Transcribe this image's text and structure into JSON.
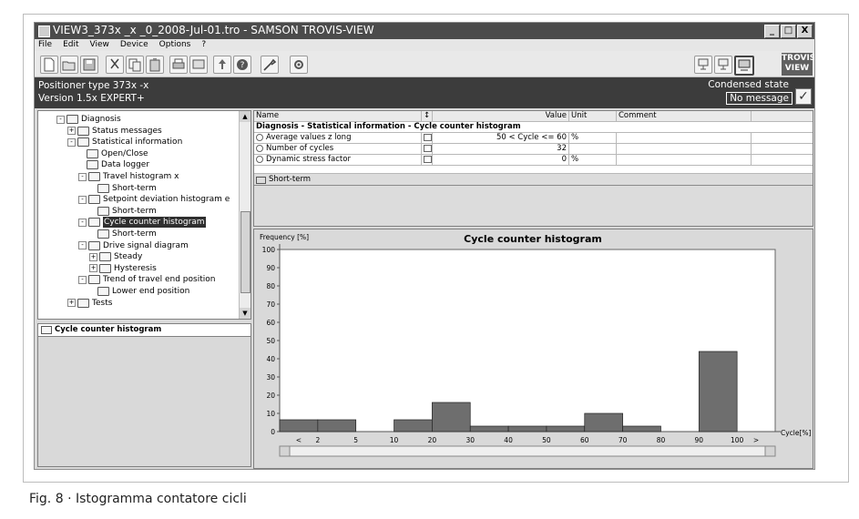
{
  "window": {
    "title": "VIEW3_373x _x _0_2008-Jul-01.tro - SAMSON TROVIS-VIEW",
    "controls": [
      "_",
      "□",
      "X"
    ]
  },
  "menu": [
    "File",
    "Edit",
    "View",
    "Device",
    "Options",
    "?"
  ],
  "toolbar": {
    "icons": [
      "new-icon",
      "open-icon",
      "save-icon",
      "cut-icon",
      "copy-icon",
      "paste-icon",
      "print-icon",
      "display-icon",
      "upload-icon",
      "help-icon",
      "tool-icon",
      "settings-icon"
    ],
    "right_icons": [
      "device-online-icon",
      "device-offline-icon",
      "monitor-icon"
    ],
    "logo_line1": "TROVIS",
    "logo_line2": "VIEW"
  },
  "infobar": {
    "positioner": "Positioner type 373x -x",
    "version": "Version 1.5x EXPERT+",
    "condensed_state": "Condensed state",
    "message": "No message"
  },
  "tree": [
    {
      "label": "Diagnosis",
      "level": 0,
      "pm": "-"
    },
    {
      "label": "Status messages",
      "level": 1,
      "pm": "+"
    },
    {
      "label": "Statistical information",
      "level": 1,
      "pm": "-"
    },
    {
      "label": "Open/Close",
      "level": 2,
      "pm": ""
    },
    {
      "label": "Data logger",
      "level": 2,
      "pm": ""
    },
    {
      "label": "Travel histogram x",
      "level": 2,
      "pm": "-"
    },
    {
      "label": "Short-term",
      "level": 3,
      "pm": ""
    },
    {
      "label": "Setpoint deviation histogram e",
      "level": 2,
      "pm": "-"
    },
    {
      "label": "Short-term",
      "level": 3,
      "pm": ""
    },
    {
      "label": "Cycle counter histogram",
      "level": 2,
      "pm": "-",
      "selected": true
    },
    {
      "label": "Short-term",
      "level": 3,
      "pm": ""
    },
    {
      "label": "Drive signal diagram",
      "level": 2,
      "pm": "-"
    },
    {
      "label": "Steady",
      "level": 3,
      "pm": "+"
    },
    {
      "label": "Hysteresis",
      "level": 3,
      "pm": "+"
    },
    {
      "label": "Trend of travel end position",
      "level": 2,
      "pm": "-"
    },
    {
      "label": "Lower end position",
      "level": 3,
      "pm": ""
    },
    {
      "label": "Tests",
      "level": 1,
      "pm": "+"
    }
  ],
  "lower_panel": {
    "header": "Cycle counter histogram"
  },
  "grid": {
    "columns": [
      "Name",
      "↕",
      "Value",
      "Unit",
      "Comment"
    ],
    "section": "Diagnosis - Statistical information - Cycle counter histogram",
    "rows": [
      {
        "name": "Average values z long",
        "value": "50 < Cycle <= 60",
        "unit": "%"
      },
      {
        "name": "Number of cycles",
        "value": "32",
        "unit": ""
      },
      {
        "name": "Dynamic stress factor",
        "value": "0",
        "unit": "%"
      }
    ],
    "subfolder": "Short-term"
  },
  "chart_data": {
    "type": "bar",
    "title": "Cycle counter histogram",
    "ylabel": "Frequency [%]",
    "xlabel": "Cycle[%]",
    "ylim": [
      0,
      100
    ],
    "yticks": [
      0,
      10,
      20,
      30,
      40,
      50,
      60,
      70,
      80,
      90,
      100
    ],
    "categories": [
      "<",
      "2",
      "5",
      "10",
      "20",
      "30",
      "40",
      "50",
      "60",
      "70",
      "80",
      "90",
      "100",
      ">"
    ],
    "values": [
      6.5,
      6.5,
      0,
      6.5,
      16,
      3,
      3,
      3,
      10,
      3,
      0,
      44,
      0
    ],
    "bar_color": "#6e6e6e",
    "grid": false
  },
  "caption": "Fig. 8 · Istogramma contatore cicli"
}
